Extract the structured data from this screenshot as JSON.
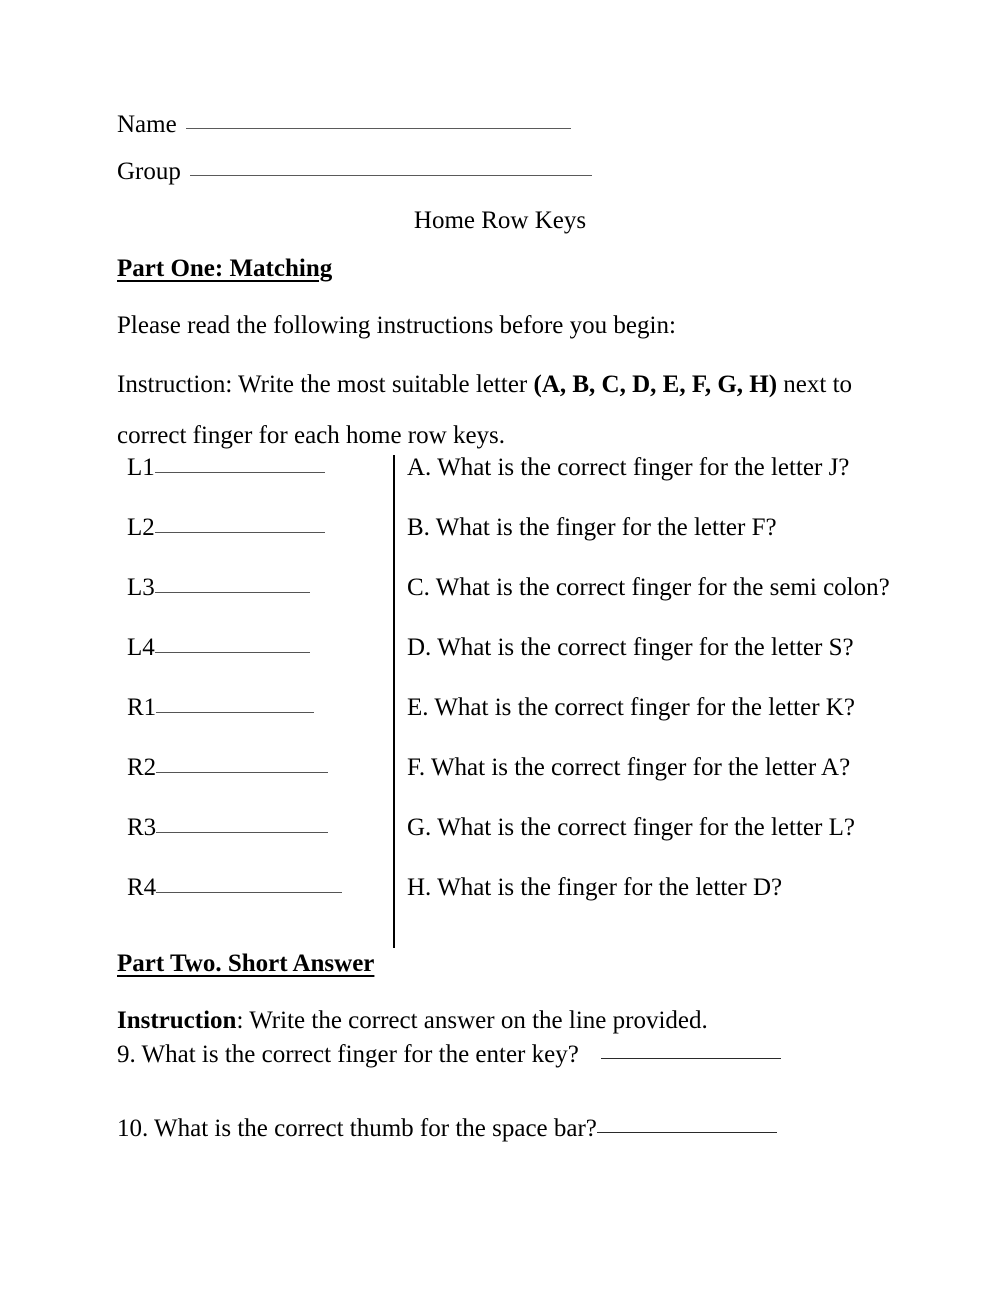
{
  "document": {
    "title": "Home Row Keys",
    "fields": [
      {
        "label": "Name",
        "value": ""
      },
      {
        "label": "Group",
        "value": ""
      }
    ]
  },
  "part_one": {
    "heading": "Part One: Matching",
    "read_instructions": "Please read the following instructions before you begin:",
    "instruction_prefix": "Instruction: Write the most suitable letter ",
    "instruction_letters": "(A, B, C, D, E, F, G, H)",
    "instruction_suffix": " next to correct finger for each home row keys.",
    "slots": [
      {
        "label": "L1",
        "answer": ""
      },
      {
        "label": "L2",
        "answer": ""
      },
      {
        "label": "L3",
        "answer": ""
      },
      {
        "label": "L4",
        "answer": ""
      },
      {
        "label": "R1",
        "answer": ""
      },
      {
        "label": "R2",
        "answer": ""
      },
      {
        "label": "R3",
        "answer": ""
      },
      {
        "label": "R4",
        "answer": ""
      }
    ],
    "questions": [
      {
        "letter": "A.",
        "text": "A. What is the correct finger for the letter J?"
      },
      {
        "letter": "B.",
        "text": "B. What is the finger for the letter F?"
      },
      {
        "letter": "C.",
        "text": "C. What is the correct finger for the semi colon?"
      },
      {
        "letter": "D.",
        "text": "D. What is the correct finger for the letter S?"
      },
      {
        "letter": "E.",
        "text": "E. What is the correct finger for the letter K?"
      },
      {
        "letter": "F.",
        "text": "F. What is the correct finger for the letter A?"
      },
      {
        "letter": "G.",
        "text": "G. What is the correct finger for the letter L?"
      },
      {
        "letter": "H.",
        "text": "H. What is the finger for the letter D?"
      }
    ]
  },
  "part_two": {
    "heading": "Part Two. Short Answer",
    "instruction_label": "Instruction",
    "instruction_text": ": Write the correct answer on the line provided.",
    "questions": [
      {
        "number": "9.",
        "text": "9. What is the correct finger for the enter key?",
        "answer": ""
      },
      {
        "number": "10.",
        "text": "10. What is the correct thumb for the space bar?",
        "answer": ""
      }
    ]
  },
  "style": {
    "page_background": "#ffffff",
    "text_color": "#000000",
    "rule_color": "#555555",
    "divider_color": "#000000"
  }
}
